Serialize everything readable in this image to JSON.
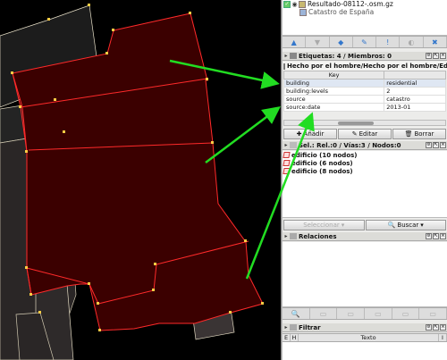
{
  "layers": [
    {
      "name": "Resultado-08112-.osm.gz",
      "active": true
    },
    {
      "name": "Catastro de España",
      "active": false
    }
  ],
  "layer_toolbar": [
    "up-arrow-icon",
    "down-arrow-icon",
    "layers-icon",
    "merge-icon",
    "info-icon",
    "opacity-icon",
    "delete-icon"
  ],
  "tags_panel": {
    "title": "Etiquetas: 4 / Miembros: 0",
    "preset": "Hecho por el hombre/Hecho por el hombre/Edific",
    "column_key": "Key",
    "rows": [
      {
        "key": "building",
        "value": "residential"
      },
      {
        "key": "building:levels",
        "value": "2"
      },
      {
        "key": "source",
        "value": "catastro"
      },
      {
        "key": "source:date",
        "value": "2013-01"
      }
    ],
    "add_label": "Añadir",
    "edit_label": "Editar",
    "delete_label": "Borrar"
  },
  "selection_panel": {
    "title": "Sel.: Rel.:0 / Vías:3 / Nodos:0",
    "items": [
      "edificio (10 nodos)",
      "edificio (6 nodos)",
      "edificio (8 nodos)"
    ],
    "select_label": "Seleccionar",
    "search_label": "Buscar"
  },
  "relations_panel": {
    "title": "Relaciones"
  },
  "filter_panel": {
    "title": "Filtrar",
    "col_e": "E",
    "col_h": "H",
    "col_text": "Texto",
    "col_i": "I"
  },
  "colors": {
    "building_fill": "#3b0000",
    "building_stroke": "#ff2a2a",
    "node": "#ffcc44",
    "arrow": "#22dd22"
  }
}
